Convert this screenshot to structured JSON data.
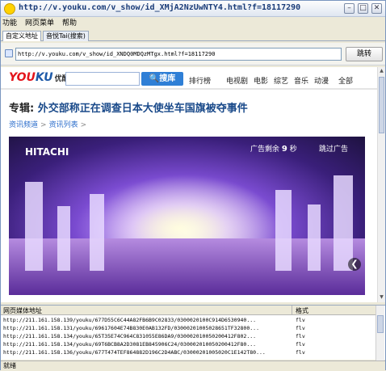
{
  "window": {
    "title": "http://v.youku.com/v_show/id_XMjA2NzUwNTY4.html?f=18117290"
  },
  "menubar": {
    "items": [
      "功能",
      "网页菜单",
      "帮助"
    ]
  },
  "tabs": [
    {
      "label": "自定义地址"
    },
    {
      "label": "音悦Tai(搜索)"
    }
  ],
  "address": {
    "value": "http://v.youku.com/v_show/id_XNDQ0MDQzMTgx.html?f=18117290",
    "go_label": "跳转"
  },
  "youku": {
    "logo_text": "YOUKU",
    "logo_cn": "优酷",
    "search_button": "搜库",
    "nav": [
      "排行榜",
      "电视剧",
      "电影",
      "综艺",
      "音乐",
      "动漫",
      "全部"
    ]
  },
  "article": {
    "label": "专辑:",
    "headline": "外交部称正在调查日本大使坐车国旗被夺事件",
    "breadcrumbs": [
      "资讯频道",
      "资讯列表"
    ]
  },
  "player": {
    "brand": "HITACHI",
    "ad_prefix": "广告剩余",
    "ad_seconds": "9",
    "ad_unit": "秒",
    "skip_label": "跳过广告",
    "next_glyph": "❮"
  },
  "media_list": {
    "headers": [
      "网页媒体地址",
      "格式"
    ],
    "rows": [
      {
        "url": "http://211.161.158.139/youku/677D55C6C44A82FB6B9C02833/0300020100C914D6530940...",
        "format": "flv"
      },
      {
        "url": "http://211.161.158.131/youku/69617604E74B830E0AB132FD/03000201005028651TF32800...",
        "format": "flv"
      },
      {
        "url": "http://211.161.158.134/youku/65T35E74C964C831055E86DA9/030002010050200412F802...",
        "format": "flv"
      },
      {
        "url": "http://211.161.158.134/youku/69T6BCB8A2D3081EB845906C24/030002010050200412F80...",
        "format": "flv"
      },
      {
        "url": "http://211.161.158.136/youku/677T474TEF864882D196C2D4ABC/03000201005020C1E142T80...",
        "format": "flv"
      }
    ]
  },
  "status": {
    "text": "就绪"
  }
}
